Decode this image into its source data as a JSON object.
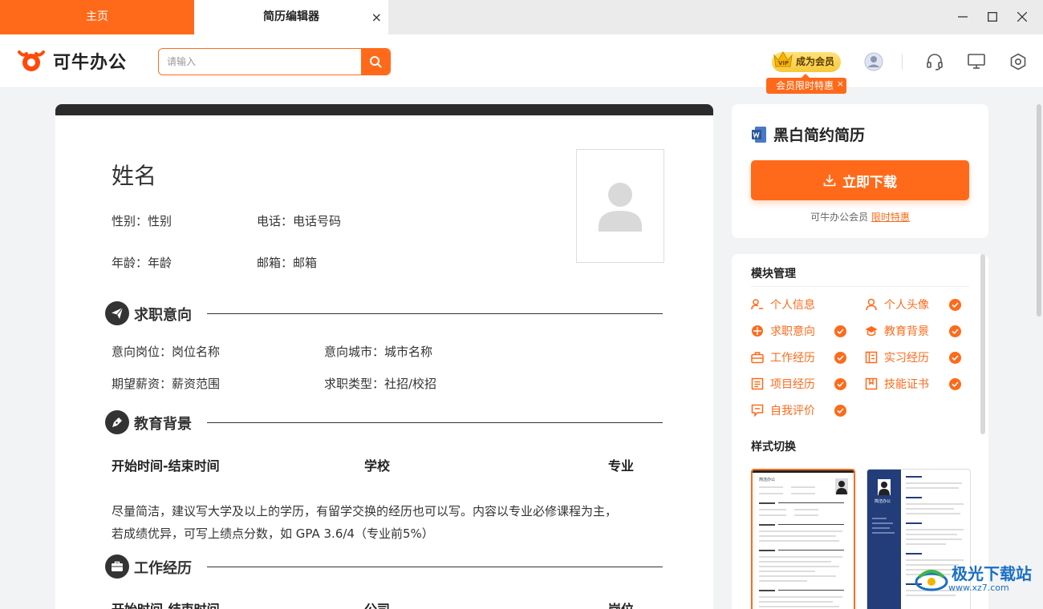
{
  "tabs": [
    {
      "label": "主页",
      "active": false
    },
    {
      "label": "简历编辑器",
      "active": true,
      "close": "×"
    }
  ],
  "header": {
    "logo_text": "可牛办公",
    "search_placeholder": "请输入",
    "vip_label": "成为会员",
    "vip_badge_text": "VIP",
    "vip_tip": "会员限时特惠",
    "vip_tip_close": "×"
  },
  "resume": {
    "name": "姓名",
    "gender": "性别：性别",
    "phone": "电话：电话号码",
    "age": "年龄：年龄",
    "email": "邮箱：邮箱",
    "sections": {
      "job_intent": {
        "title": "求职意向",
        "position": "意向岗位：岗位名称",
        "city": "意向城市：城市名称",
        "salary": "期望薪资：薪资范围",
        "type": "求职类型：社招/校招"
      },
      "education": {
        "title": "教育背景",
        "col_time": "开始时间-结束时间",
        "col_school": "学校",
        "col_major": "专业",
        "desc_line1": "尽量简洁，建议写大学及以上的学历，有留学交换的经历也可以写。内容以专业必修课程为主，",
        "desc_line2": "若成绩优异，可写上绩点分数，如 GPA 3.6/4（专业前5%）"
      },
      "work": {
        "title": "工作经历",
        "col_time": "开始时间-结束时间",
        "col_company": "公司",
        "col_role": "岗位"
      }
    }
  },
  "sidebar": {
    "template_name": "黑白简约简历",
    "download_label": "立即下载",
    "member_text": "可牛办公会员",
    "member_link": "限时特惠",
    "module_title": "模块管理",
    "modules": [
      {
        "label": "个人信息",
        "icon": "user-edit-icon",
        "checked": false
      },
      {
        "label": "个人头像",
        "icon": "avatar-icon",
        "checked": true
      },
      {
        "label": "求职意向",
        "icon": "compass-icon",
        "checked": true
      },
      {
        "label": "教育背景",
        "icon": "graduation-cap-icon",
        "checked": true
      },
      {
        "label": "工作经历",
        "icon": "briefcase-icon",
        "checked": true
      },
      {
        "label": "实习经历",
        "icon": "clipboard-icon",
        "checked": true
      },
      {
        "label": "项目经历",
        "icon": "document-icon",
        "checked": true
      },
      {
        "label": "技能证书",
        "icon": "certificate-icon",
        "checked": true
      },
      {
        "label": "自我评价",
        "icon": "comment-icon",
        "checked": true
      }
    ],
    "style_title": "样式切换",
    "style_thumb1_name": "简洁办公",
    "style_thumb2_name": "简洁办公"
  },
  "watermark": {
    "text": "极光下载站",
    "url": "www.xz7.com"
  },
  "colors": {
    "accent": "#ff6a1a",
    "dark": "#2b2b2b"
  }
}
